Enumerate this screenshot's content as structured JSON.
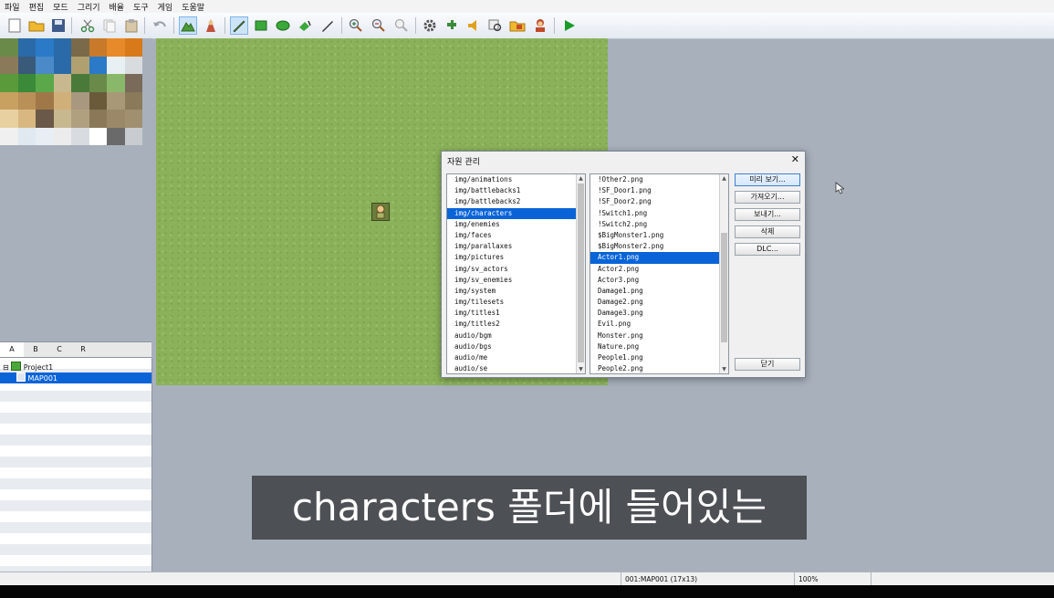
{
  "menu": [
    "파일",
    "편집",
    "모드",
    "그리기",
    "배율",
    "도구",
    "게임",
    "도움말"
  ],
  "toolbar": {
    "icons": [
      "new-project",
      "open-project",
      "save-project",
      "cut",
      "copy",
      "paste",
      "undo",
      "map-mode",
      "event-mode",
      "pencil",
      "rectangle",
      "ellipse",
      "fill",
      "shadow-pen",
      "zoom-in",
      "zoom-out",
      "zoom-actual",
      "database",
      "plugin-manager",
      "sound-test",
      "event-searcher",
      "resource-manager",
      "character-generator",
      "playtest"
    ]
  },
  "tileset_tabs": [
    "A",
    "B",
    "C",
    "R"
  ],
  "map_tree": {
    "project": "Project1",
    "selected_map": "MAP001"
  },
  "dialog": {
    "title": "자원 관리",
    "folders": [
      "img/animations",
      "img/battlebacks1",
      "img/battlebacks2",
      "img/characters",
      "img/enemies",
      "img/faces",
      "img/parallaxes",
      "img/pictures",
      "img/sv_actors",
      "img/sv_enemies",
      "img/system",
      "img/tilesets",
      "img/titles1",
      "img/titles2",
      "audio/bgm",
      "audio/bgs",
      "audio/me",
      "audio/se"
    ],
    "selected_folder": 3,
    "files": [
      "!Other2.png",
      "!SF_Door1.png",
      "!SF_Door2.png",
      "!Switch1.png",
      "!Switch2.png",
      "$BigMonster1.png",
      "$BigMonster2.png",
      "Actor1.png",
      "Actor2.png",
      "Actor3.png",
      "Damage1.png",
      "Damage2.png",
      "Damage3.png",
      "Evil.png",
      "Monster.png",
      "Nature.png",
      "People1.png",
      "People2.png"
    ],
    "selected_file": 7,
    "buttons": {
      "preview": "미리 보기...",
      "import": "가져오기...",
      "export": "보내기...",
      "delete": "삭제",
      "dlc": "DLC...",
      "close": "닫기"
    }
  },
  "caption": "characters 폴더에 들어있는",
  "status": {
    "map_info": "001:MAP001 (17x13)",
    "zoom": "100%"
  }
}
